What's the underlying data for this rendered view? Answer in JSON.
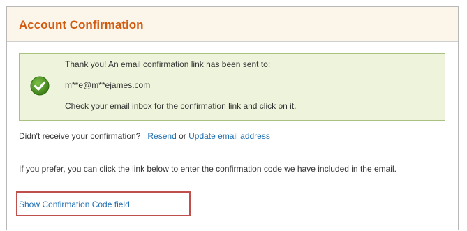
{
  "header": {
    "title": "Account Confirmation"
  },
  "success_message": {
    "icon": "checkmark-icon",
    "line1": "Thank you! An email confirmation link has been sent to:",
    "email": "m**e@m**ejames.com",
    "line3": "Check your email inbox for the confirmation link and click on it.",
    "colors": {
      "background": "#eef4dc",
      "border": "#a9c27f",
      "icon": "#4e8f22"
    }
  },
  "resend": {
    "prompt": "Didn't receive your confirmation?",
    "resend_label": "Resend",
    "or_label": "or",
    "update_label": "Update email address"
  },
  "confirmation_code": {
    "description": "If you prefer, you can click the link below to enter the confirmation code we have included in the email.",
    "show_field_label": "Show Confirmation Code field",
    "highlight_color": "#c0504d"
  },
  "colors": {
    "title": "#d15a0e",
    "link": "#1f6fb2",
    "text": "#333333"
  }
}
